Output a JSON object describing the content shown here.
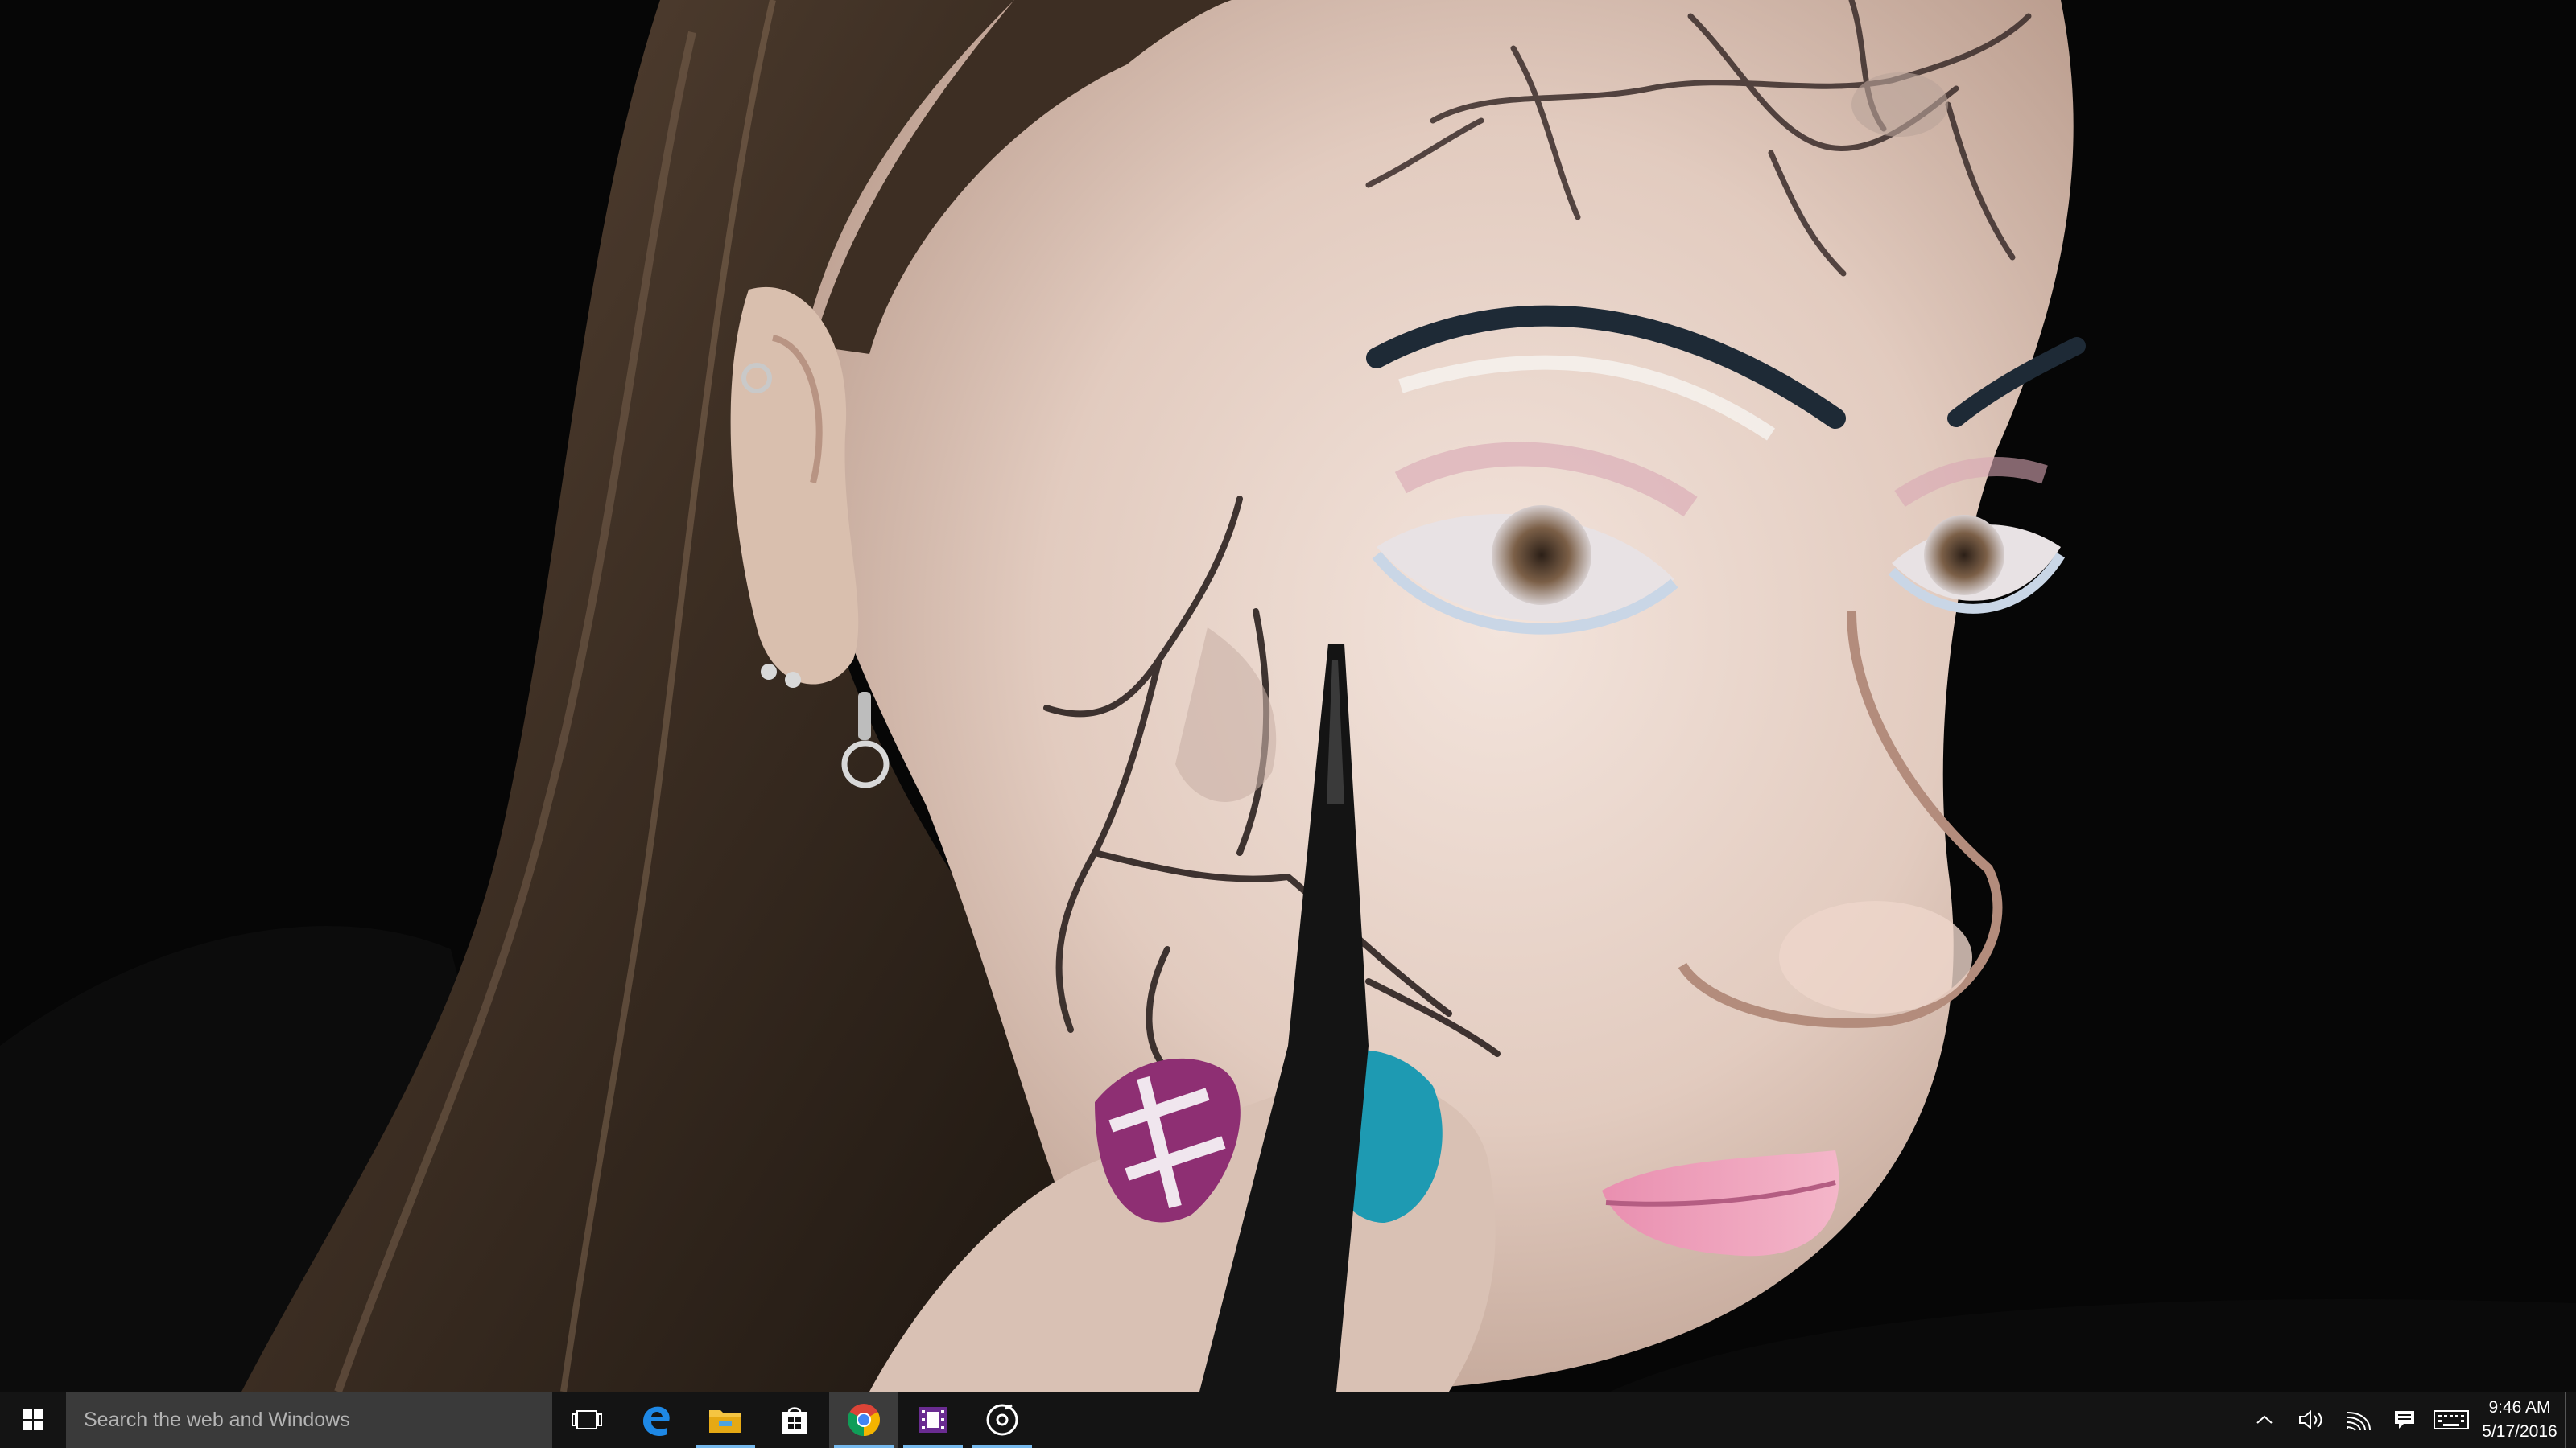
{
  "taskbar": {
    "start": {
      "icon": "windows-logo-icon"
    },
    "search": {
      "placeholder": "Search the web and Windows",
      "icon": "search-box"
    },
    "pinned": [
      {
        "name": "task-view",
        "icon": "task-view-icon",
        "running": false
      },
      {
        "name": "edge",
        "icon": "edge-icon",
        "running": false
      },
      {
        "name": "file-explorer",
        "icon": "folder-icon",
        "running": true
      },
      {
        "name": "store",
        "icon": "store-icon",
        "running": false
      },
      {
        "name": "chrome",
        "icon": "chrome-icon",
        "running": true,
        "active": true
      },
      {
        "name": "movies-tv",
        "icon": "film-icon",
        "running": true
      },
      {
        "name": "groove-music",
        "icon": "music-disc-icon",
        "running": true
      }
    ],
    "tray": [
      {
        "name": "show-hidden-icons",
        "icon": "chevron-up-icon"
      },
      {
        "name": "volume",
        "icon": "speaker-icon"
      },
      {
        "name": "network",
        "icon": "wifi-icon"
      },
      {
        "name": "action-center",
        "icon": "message-icon"
      },
      {
        "name": "touch-keyboard",
        "icon": "keyboard-icon"
      }
    ],
    "clock": {
      "time": "9:46 AM",
      "date": "5/17/2016"
    }
  },
  "colors": {
    "taskbar_bg": "#141414",
    "search_bg": "#3a3a3a",
    "running_indicator": "#76b9ed",
    "chrome_red": "#db4437",
    "chrome_green": "#0f9d58",
    "chrome_yellow": "#f4b400",
    "chrome_blue": "#4285f4",
    "edge_blue": "#1e88e5",
    "video_purple": "#6a2c91"
  }
}
